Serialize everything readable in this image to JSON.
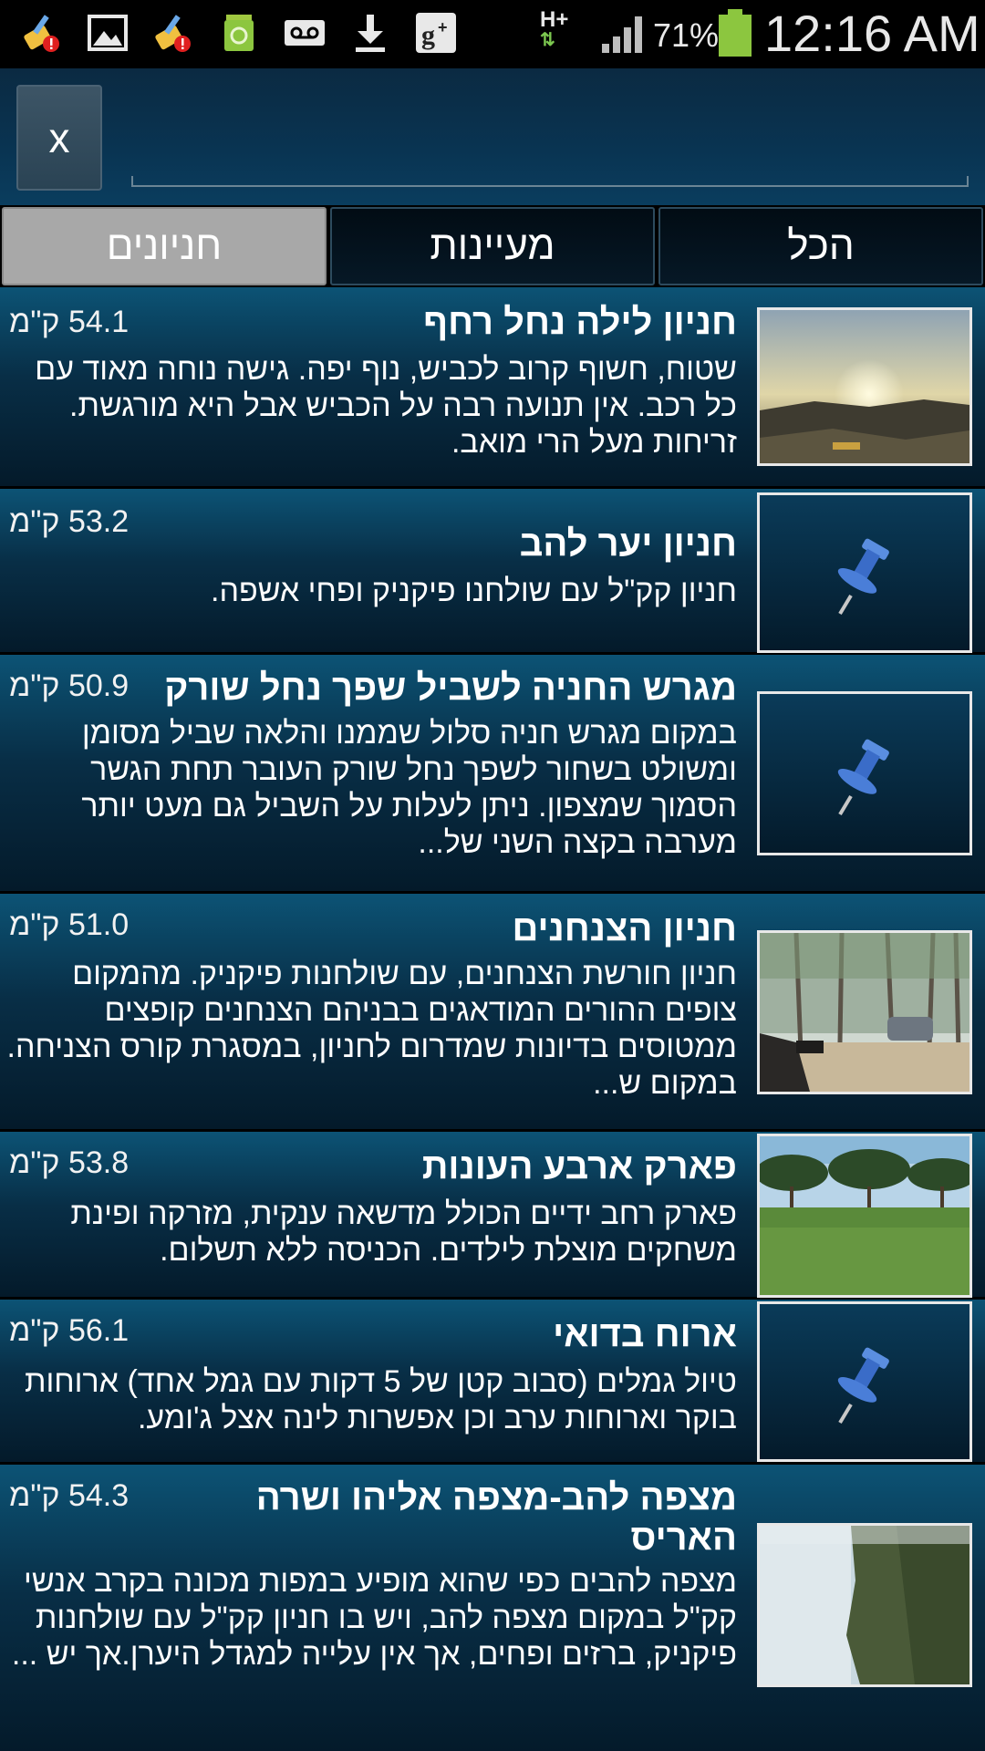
{
  "status_bar": {
    "icons": [
      "cleaner-alert-icon",
      "image-icon",
      "cleaner-alert-icon",
      "recycle-icon",
      "voicemail-icon",
      "download-icon",
      "google-plus-icon",
      "network-hplus-icon",
      "signal-icon",
      "battery-icon"
    ],
    "network": "H+",
    "battery": "71%",
    "time": "12:16 AM"
  },
  "header": {
    "close_label": "x",
    "search_value": ""
  },
  "tabs": [
    {
      "label": "הכל",
      "active": false
    },
    {
      "label": "מעיינות",
      "active": false
    },
    {
      "label": "חניונים",
      "active": true
    }
  ],
  "items": [
    {
      "title": "חניון לילה נחל רחף",
      "distance": "54.1 ק\"מ",
      "description": "שטוח, חשוף קרוב לכביש, נוף יפה. גישה נוחה מאוד עם כל רכב.  אין תנועה רבה על הכביש אבל היא מורגשת. זריחות מעל הרי מואב.",
      "thumb": "sunrise-photo"
    },
    {
      "title": "חניון יער להב",
      "distance": "53.2 ק\"מ",
      "description": "חניון קק\"ל עם שולחנו פיקניק ופחי אשפה.",
      "thumb": "pushpin-icon"
    },
    {
      "title": "מגרש החניה לשביל שפך נחל שורק",
      "distance": "50.9 ק\"מ",
      "description": "במקום מגרש חניה סלול שממנו והלאה שביל מסומן ומשולט בשחור לשפך נחל שורק העובר תחת הגשר הסמוך שמצפון. ניתן לעלות על השביל גם מעט יותר מערבה בקצה השני של...",
      "thumb": "pushpin-icon"
    },
    {
      "title": "חניון הצנחנים",
      "distance": "51.0 ק\"מ",
      "description": "חניון חורשת הצנחנים, עם שולחנות פיקניק. מהמקום צופים ההורים המודאגים בבניהם הצנחנים קופצים ממטוסים בדיונות שמדרום לחניון, במסגרת קורס הצניחה.  במקום ש...",
      "thumb": "forest-photo"
    },
    {
      "title": "פארק ארבע העונות",
      "distance": "53.8 ק\"מ",
      "description": "פארק רחב ידיים הכולל מדשאה ענקית, מזרקה ופינת משחקים מוצלת לילדים.   הכניסה ללא תשלום.",
      "thumb": "park-photo"
    },
    {
      "title": "ארוח בדואי",
      "distance": "56.1 ק\"מ",
      "description": "טיול גמלים (סבוב קטן של 5 דקות עם גמל אחד) ארוחות בוקר וארוחות ערב וכן אפשרות לינה אצל ג'ומע.",
      "thumb": "pushpin-icon"
    },
    {
      "title": "מצפה להב-מצפה אליהו ושרה האריס",
      "distance": "54.3 ק\"מ",
      "description": "מצפה להבים כפי שהוא מופיע במפות מכונה בקרב אנשי קק\"ל במקום מצפה להב, ויש בו חניון קק\"ל עם שולחנות פיקניק, ברזים ופחים, אך אין עלייה למגדל היערן.אך יש ...",
      "thumb": "lookout-photo"
    }
  ]
}
